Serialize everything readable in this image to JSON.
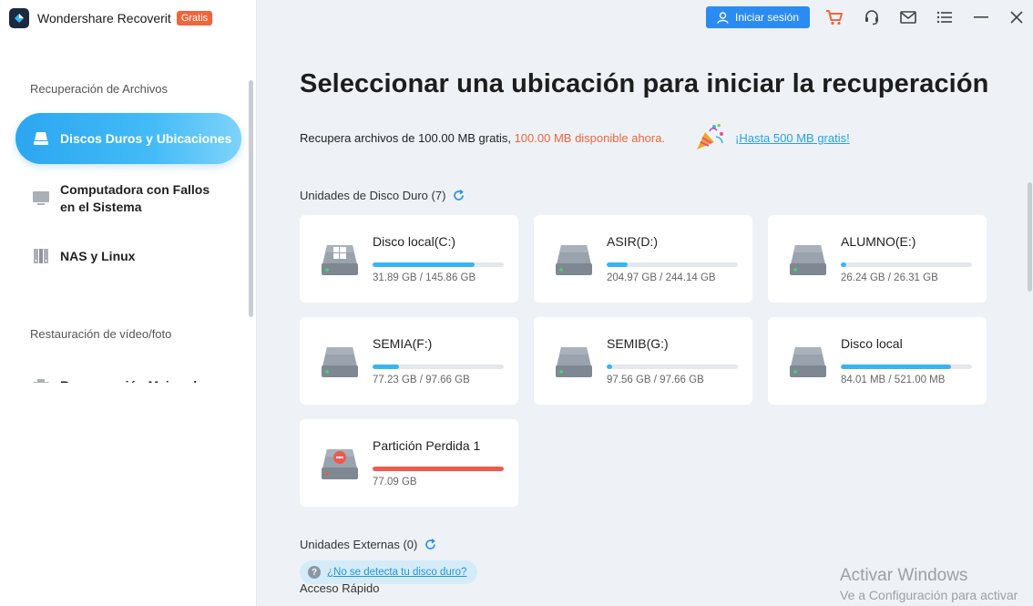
{
  "app": {
    "name": "Wondershare Recoverit",
    "badge": "Gratis"
  },
  "sidebar": {
    "section_files": "Recuperación de Archivos",
    "items": [
      {
        "label": "Discos Duros y Ubicaciones",
        "icon": "hard-drive-icon",
        "active": true
      },
      {
        "label": "Computadora con Fallos en el Sistema",
        "icon": "monitor-icon"
      },
      {
        "label": "NAS y Linux",
        "icon": "server-icon"
      }
    ],
    "section_media": "Restauración de vídeo/foto",
    "media_item": "Recuperación Mejorada"
  },
  "topbar": {
    "login_label": "Iniciar sesión",
    "icons": [
      "cart-icon",
      "headset-icon",
      "mail-icon",
      "menu-icon",
      "minimize-icon",
      "close-icon"
    ]
  },
  "main": {
    "title": "Seleccionar una ubicación para iniciar la recuperación",
    "info_prefix": "Recupera archivos de 100.00 MB gratis, ",
    "info_available": "100.00 MB disponible ahora.",
    "promo_link": "¡Hasta 500 MB gratis!",
    "hard_drives_title": "Unidades de Disco Duro (7)",
    "drives": [
      {
        "name": "Disco local(C:)",
        "size": "31.89 GB / 145.86 GB",
        "usage": 0.78,
        "windows": true,
        "lost": false
      },
      {
        "name": "ASIR(D:)",
        "size": "204.97 GB / 244.14 GB",
        "usage": 0.16,
        "windows": false,
        "lost": false
      },
      {
        "name": "ALUMNO(E:)",
        "size": "26.24 GB / 26.31 GB",
        "usage": 0.04,
        "windows": false,
        "lost": false
      },
      {
        "name": "SEMIA(F:)",
        "size": "77.23 GB / 97.66 GB",
        "usage": 0.2,
        "windows": false,
        "lost": false
      },
      {
        "name": "SEMIB(G:)",
        "size": "97.56 GB / 97.66 GB",
        "usage": 0.04,
        "windows": false,
        "lost": false
      },
      {
        "name": "Disco local",
        "size": "84.01 MB / 521.00 MB",
        "usage": 0.84,
        "windows": false,
        "lost": false
      },
      {
        "name": "Partición Perdida 1",
        "size": "77.09 GB",
        "usage": 1.0,
        "windows": false,
        "lost": true
      }
    ],
    "external_title": "Unidades Externas (0)",
    "help_link": "¿No se detecta tu disco duro?",
    "quick_access_title": "Acceso Rápido"
  },
  "watermark": {
    "line1": "Activar Windows",
    "line2": "Ve a Configuración para activar"
  },
  "colors": {
    "accent": "#2a8cf0",
    "orange": "#f0653b",
    "progress": "#37b5f3",
    "lost": "#ef5a4c"
  }
}
